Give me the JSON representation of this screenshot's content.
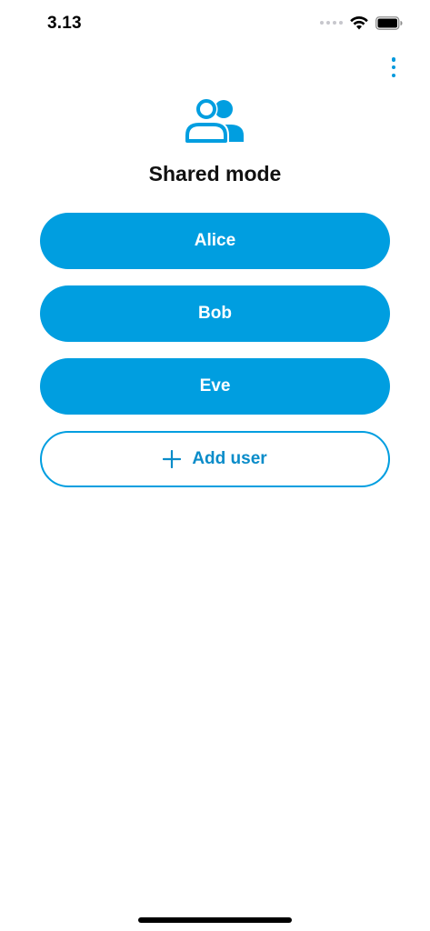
{
  "status_bar": {
    "time": "3.13",
    "icons": [
      "signal-dots-icon",
      "wifi-icon",
      "battery-icon"
    ]
  },
  "menu": {
    "icon": "kebab-menu-icon"
  },
  "header": {
    "icon": "users-icon",
    "title": "Shared mode"
  },
  "users": [
    {
      "name": "Alice"
    },
    {
      "name": "Bob"
    },
    {
      "name": "Eve"
    }
  ],
  "add_user": {
    "icon": "plus-icon",
    "label": "Add user"
  },
  "colors": {
    "accent": "#009ee0",
    "text_dark": "#111111",
    "background": "#ffffff"
  }
}
